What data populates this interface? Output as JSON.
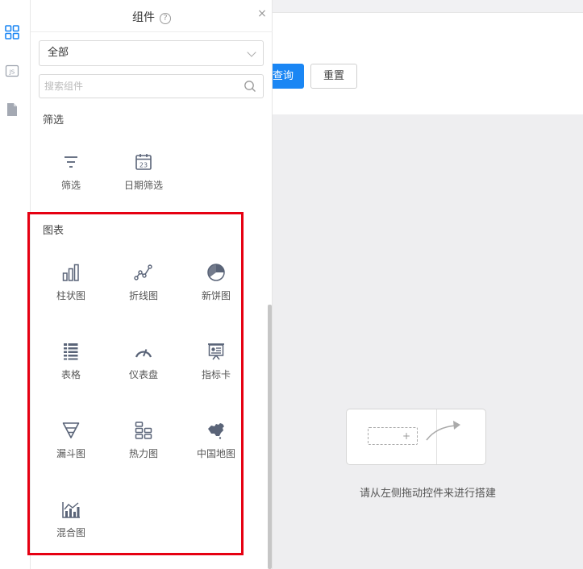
{
  "rail": {
    "icons": [
      "grid-icon",
      "js-icon",
      "file-icon"
    ],
    "js_label": "JS"
  },
  "panel": {
    "title": "组件",
    "help_mark": "?",
    "close": "×",
    "category_select": "全部",
    "search_placeholder": "搜索组件",
    "sections": {
      "filter": {
        "title": "筛选",
        "items": [
          {
            "label": "筛选",
            "icon": "filter-icon"
          },
          {
            "label": "日期筛选",
            "icon": "calendar-icon",
            "icon_text": "23"
          }
        ]
      },
      "chart": {
        "title": "图表",
        "items": [
          {
            "label": "柱状图",
            "icon": "bar-chart-icon"
          },
          {
            "label": "折线图",
            "icon": "line-chart-icon"
          },
          {
            "label": "新饼图",
            "icon": "pie-chart-icon"
          },
          {
            "label": "表格",
            "icon": "table-icon"
          },
          {
            "label": "仪表盘",
            "icon": "gauge-icon"
          },
          {
            "label": "指标卡",
            "icon": "indicator-card-icon"
          },
          {
            "label": "漏斗图",
            "icon": "funnel-icon"
          },
          {
            "label": "热力图",
            "icon": "heatmap-icon"
          },
          {
            "label": "中国地图",
            "icon": "china-map-icon"
          },
          {
            "label": "混合图",
            "icon": "mixed-chart-icon"
          }
        ]
      }
    }
  },
  "toolbar": {
    "query_label": "查询",
    "reset_label": "重置"
  },
  "canvas": {
    "plus": "+",
    "hint": "请从左侧拖动控件来进行搭建"
  },
  "colors": {
    "primary": "#1a86f4",
    "highlight": "#e60012",
    "icon": "#5a6478"
  }
}
